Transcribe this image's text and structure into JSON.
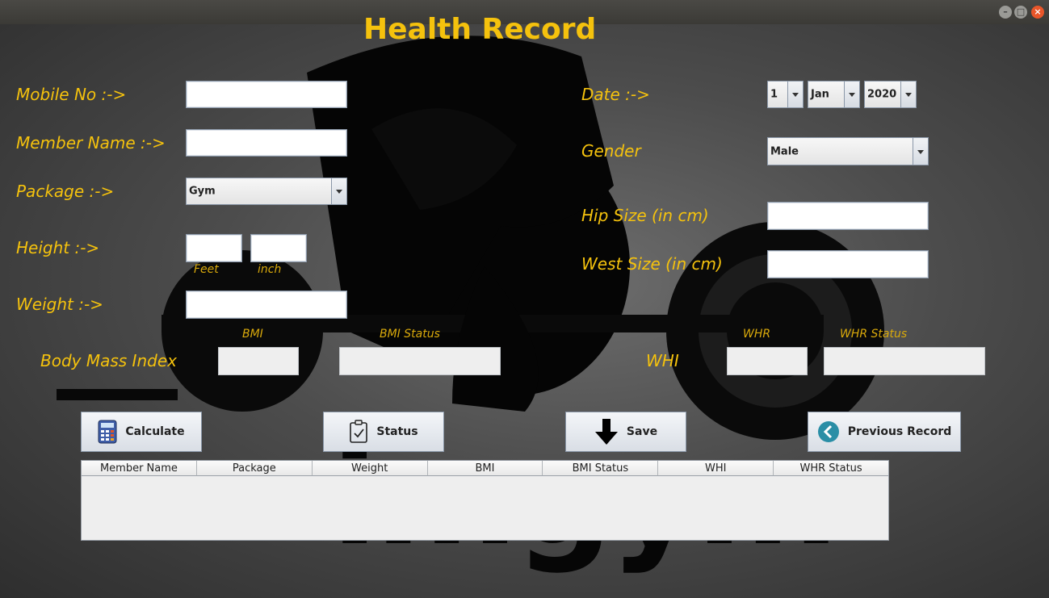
{
  "window": {
    "controls": [
      "–",
      "□",
      "×"
    ]
  },
  "title": "Health Record",
  "watermark_text": "imgym",
  "left": {
    "mobile_label": "Mobile No :->",
    "member_label": "Member Name :->",
    "package_label": "Package :->",
    "package_value": "Gym",
    "height_label": "Height :->",
    "feet_label": "Feet",
    "inch_label": "inch",
    "weight_label": "Weight :->",
    "bmi_row_label": "Body Mass Index",
    "bmi_label": "BMI",
    "bmi_status_label": "BMI Status"
  },
  "right": {
    "date_label": "Date :->",
    "day": "1",
    "month": "Jan",
    "year": "2020",
    "gender_label": "Gender",
    "gender_value": "Male",
    "hip_label": "Hip Size (in cm)",
    "waist_label": "West Size (in cm)",
    "whi_label": "WHI",
    "whr_label": "WHR",
    "whr_status_label": "WHR Status"
  },
  "buttons": {
    "calculate": "Calculate",
    "status": "Status",
    "save": "Save",
    "previous": "Previous Record"
  },
  "table": {
    "columns": [
      "Member Name",
      "Package",
      "Weight",
      "BMI",
      "BMI Status",
      "WHI",
      "WHR Status"
    ]
  },
  "colors": {
    "accent": "#f5c20d"
  }
}
